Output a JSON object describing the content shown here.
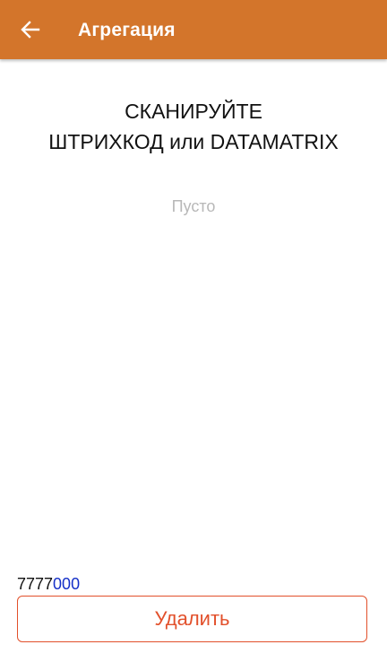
{
  "header": {
    "title": "Агрегация",
    "back_icon": "arrow-left-icon",
    "background_color": "#d3752b"
  },
  "main": {
    "prompt_line1": "СКАНИРУЙТЕ",
    "prompt_line2": "ШТРИХКОД или DATAMATRIX",
    "empty_text": "Пусто"
  },
  "footer": {
    "code_prefix": "7777",
    "code_suffix": "000",
    "code_suffix_color": "#1530c8",
    "delete_label": "Удалить",
    "delete_color": "#e2502b"
  }
}
